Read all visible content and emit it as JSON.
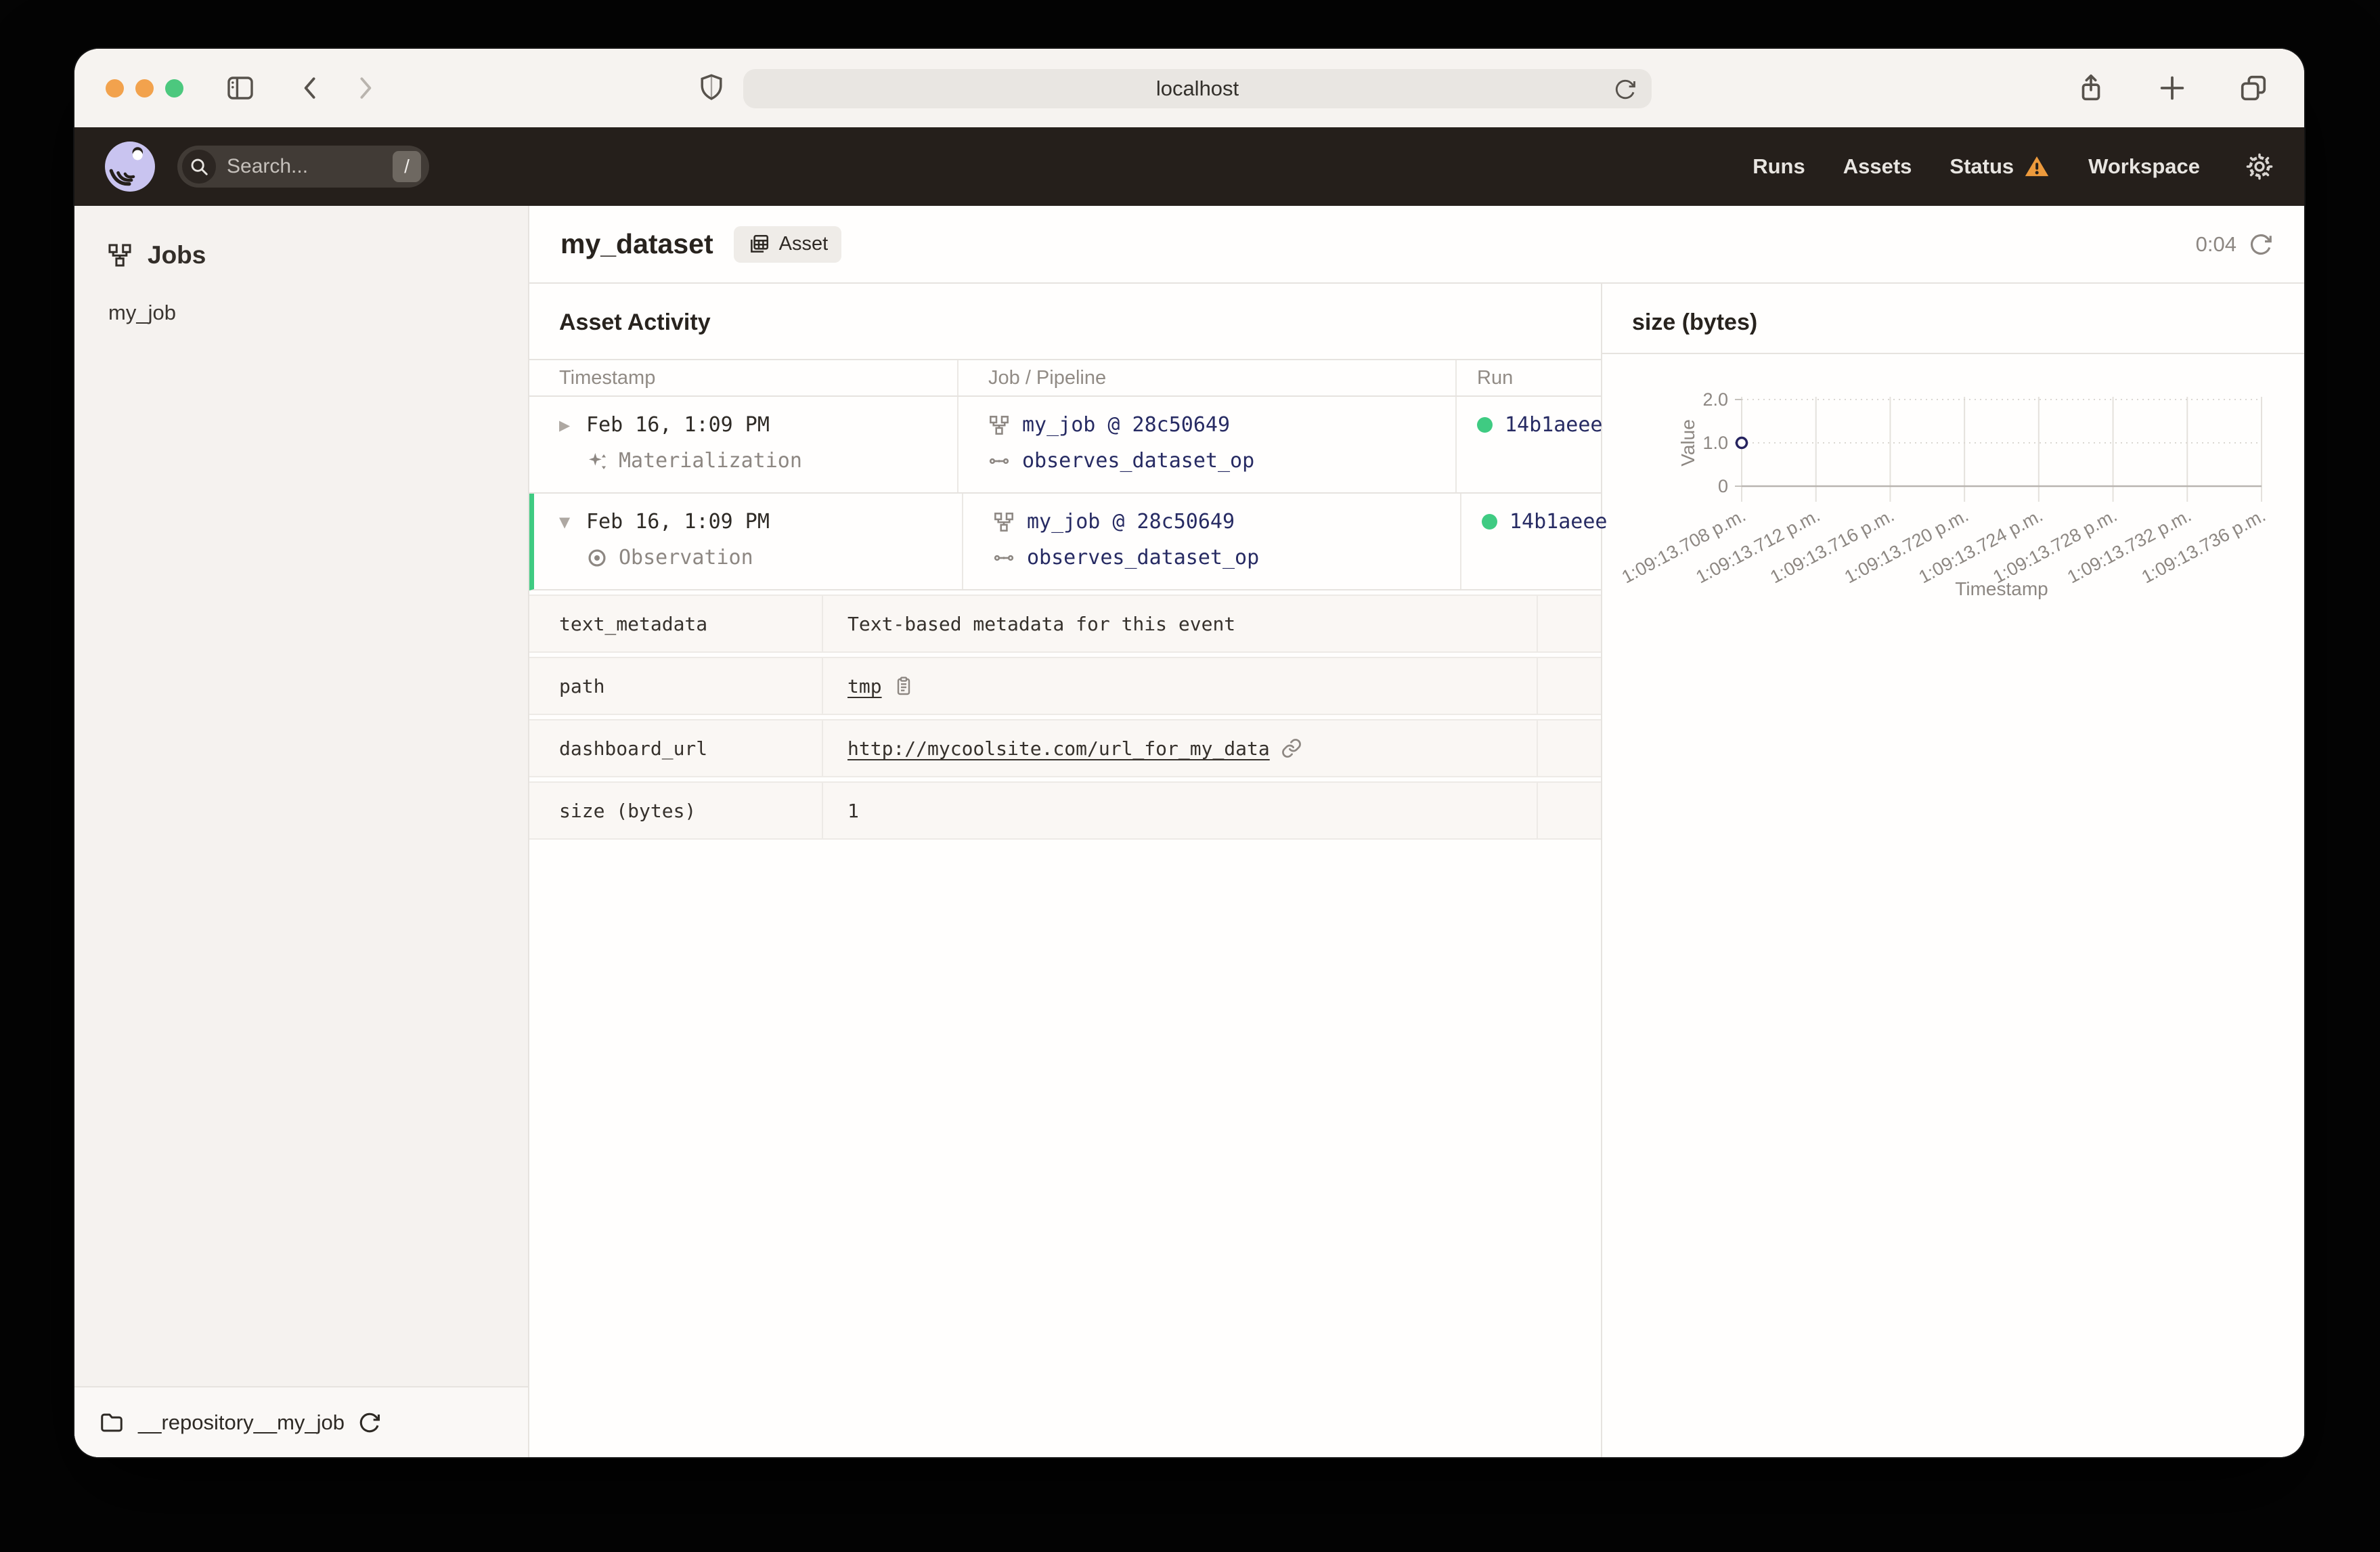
{
  "browser": {
    "url": "localhost"
  },
  "appbar": {
    "search_placeholder": "Search...",
    "search_shortcut": "/",
    "nav": [
      "Runs",
      "Assets",
      "Status",
      "Workspace"
    ]
  },
  "sidebar": {
    "title": "Jobs",
    "job": "my_job",
    "footer_repo": "__repository__my_job"
  },
  "content": {
    "title": "my_dataset",
    "tag": "Asset",
    "timer": "0:04",
    "activity_title": "Asset Activity",
    "columns": {
      "timestamp": "Timestamp",
      "job": "Job / Pipeline",
      "run": "Run"
    },
    "rows": [
      {
        "timestamp": "Feb 16, 1:09 PM",
        "event_type": "Materialization",
        "job": "my_job @ 28c50649",
        "op": "observes_dataset_op",
        "run_id": "14b1aeee",
        "expanded": false
      },
      {
        "timestamp": "Feb 16, 1:09 PM",
        "event_type": "Observation",
        "job": "my_job @ 28c50649",
        "op": "observes_dataset_op",
        "run_id": "14b1aeee",
        "expanded": true
      }
    ],
    "expand_collapsed_glyph": "▶",
    "expand_open_glyph": "▼",
    "metadata": [
      {
        "key": "text_metadata",
        "value": "Text-based metadata for this event"
      },
      {
        "key": "path",
        "value": "tmp"
      },
      {
        "key": "dashboard_url",
        "value": "http://mycoolsite.com/url_for_my_data"
      },
      {
        "key": "size (bytes)",
        "value": "1"
      }
    ]
  },
  "chart_data": {
    "type": "scatter",
    "title": "size (bytes)",
    "xlabel": "Timestamp",
    "ylabel": "Value",
    "ylim": [
      0,
      2
    ],
    "grid": true,
    "y_tick_labels": [
      "0",
      "1.0",
      "2.0"
    ],
    "x_tick_labels": [
      "1:09:13.708 p.m.",
      "1:09:13.712 p.m.",
      "1:09:13.716 p.m.",
      "1:09:13.720 p.m.",
      "1:09:13.724 p.m.",
      "1:09:13.728 p.m.",
      "1:09:13.732 p.m.",
      "1:09:13.736 p.m."
    ],
    "points": [
      {
        "x_index": 0,
        "y": 1.0
      }
    ]
  },
  "colors": {
    "header_dark": "#251F1B",
    "accent_green": "#3FCB82",
    "warning_orange": "#ED9A3C",
    "link_navy": "#272B63",
    "logo_lavender": "#C9C4F0",
    "traffic_orange": "#F2A24D",
    "traffic_green": "#4CC87E"
  }
}
